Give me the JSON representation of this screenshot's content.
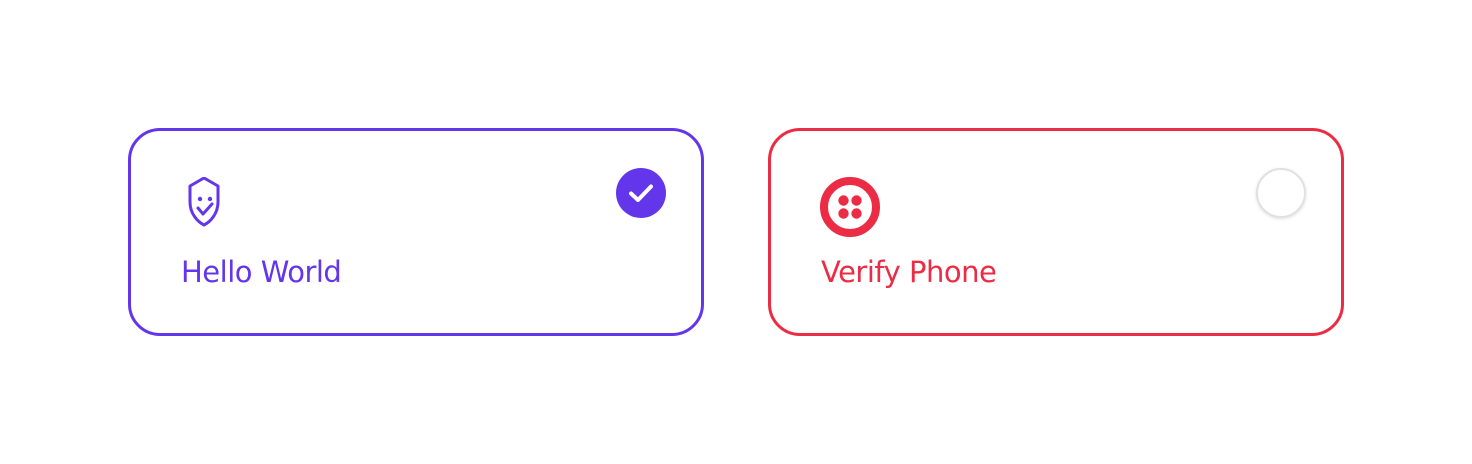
{
  "cards": [
    {
      "label": "Hello World",
      "icon": "shield-smile-icon",
      "color": "#6436EB",
      "selected": true
    },
    {
      "label": "Verify Phone",
      "icon": "twilio-logo-icon",
      "color": "#EC2B45",
      "selected": false
    }
  ]
}
